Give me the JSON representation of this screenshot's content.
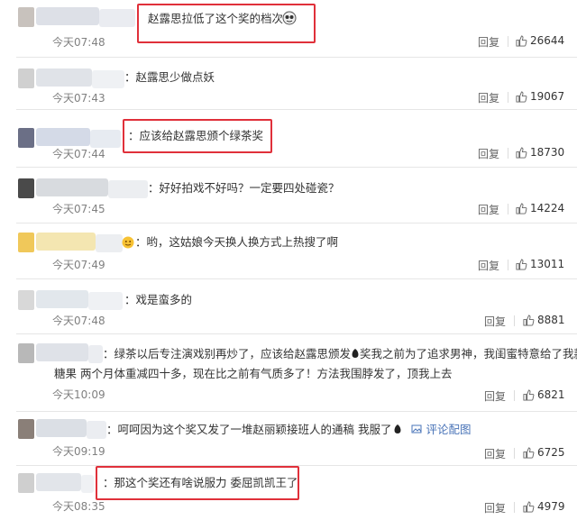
{
  "colors": {
    "highlight": "#e0303a",
    "link": "#4a74b8",
    "time": "#808080"
  },
  "comments": [
    {
      "text": "赵露思拉低了这个奖的档次",
      "time": "今天07:48",
      "reply": "回复",
      "likes": "26644",
      "highlighted": true
    },
    {
      "text": "：赵露思少做点妖",
      "time": "今天07:43",
      "reply": "回复",
      "likes": "19067",
      "highlighted": false
    },
    {
      "text": "：应该给赵露思颁个绿茶奖",
      "time": "今天07:44",
      "reply": "回复",
      "likes": "18730",
      "highlighted": true
    },
    {
      "text": "：好好拍戏不好吗？一定要四处碰瓷？",
      "time": "今天07:45",
      "reply": "回复",
      "likes": "14224",
      "highlighted": false
    },
    {
      "text": "：哟，这姑娘今天换人换方式上热搜了啊",
      "time": "今天07:49",
      "reply": "回复",
      "likes": "13011",
      "highlighted": false
    },
    {
      "text": "：戏是蛮多的",
      "time": "今天07:48",
      "reply": "回复",
      "likes": "8881",
      "highlighted": false
    },
    {
      "text_line1": "：绿茶以后专注演戏别再炒了，应该给赵露思颁发",
      "text_line1b": "奖我之前为了追求男神，我闺蜜特意给了我款",
      "text_line2": "糖果 两个月体重减四十多，现在比之前有气质多了！方法我围脖发了，顶我上去",
      "time": "今天10:09",
      "reply": "回复",
      "likes": "6821",
      "highlighted": false
    },
    {
      "text": "：呵呵因为这个奖又发了一堆赵丽颖接班人的通稿 我服了",
      "link": "评论配图",
      "time": "今天09:19",
      "reply": "回复",
      "likes": "6725",
      "highlighted": false
    },
    {
      "text": "：那这个奖还有啥说服力 委屈凯凯王了",
      "time": "今天08:35",
      "reply": "回复",
      "likes": "4979",
      "highlighted": true
    }
  ]
}
